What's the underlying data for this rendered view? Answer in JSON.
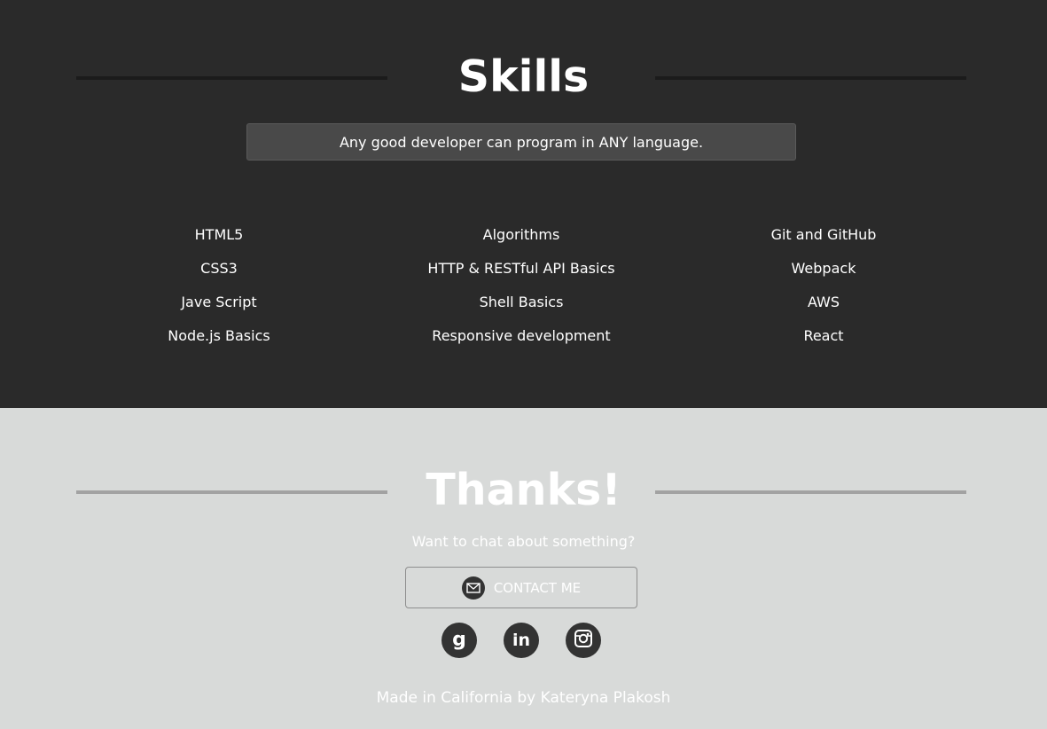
{
  "skills": {
    "title": "Skills",
    "quote": "Any good developer can program in ANY language.",
    "columns": [
      [
        "HTML5",
        "CSS3",
        "Jave Script",
        "Node.js Basics"
      ],
      [
        "Algorithms",
        "HTTP & RESTful API Basics",
        "Shell Basics",
        "Responsive development"
      ],
      [
        "Git and GitHub",
        "Webpack",
        "AWS",
        "React"
      ]
    ]
  },
  "thanks": {
    "title": "Thanks!",
    "subtitle": "Want to chat about something?",
    "contact_label": "CONTACT ME",
    "social_icons": [
      "goodreads-icon",
      "linkedin-icon",
      "instagram-icon"
    ],
    "footer": "Made in California by Kateryna Plakosh"
  },
  "colors": {
    "dark_bg": "#2a2a2a",
    "light_bg": "#d8dad9",
    "quote_bg": "#494949",
    "icon_bg": "#333333"
  }
}
